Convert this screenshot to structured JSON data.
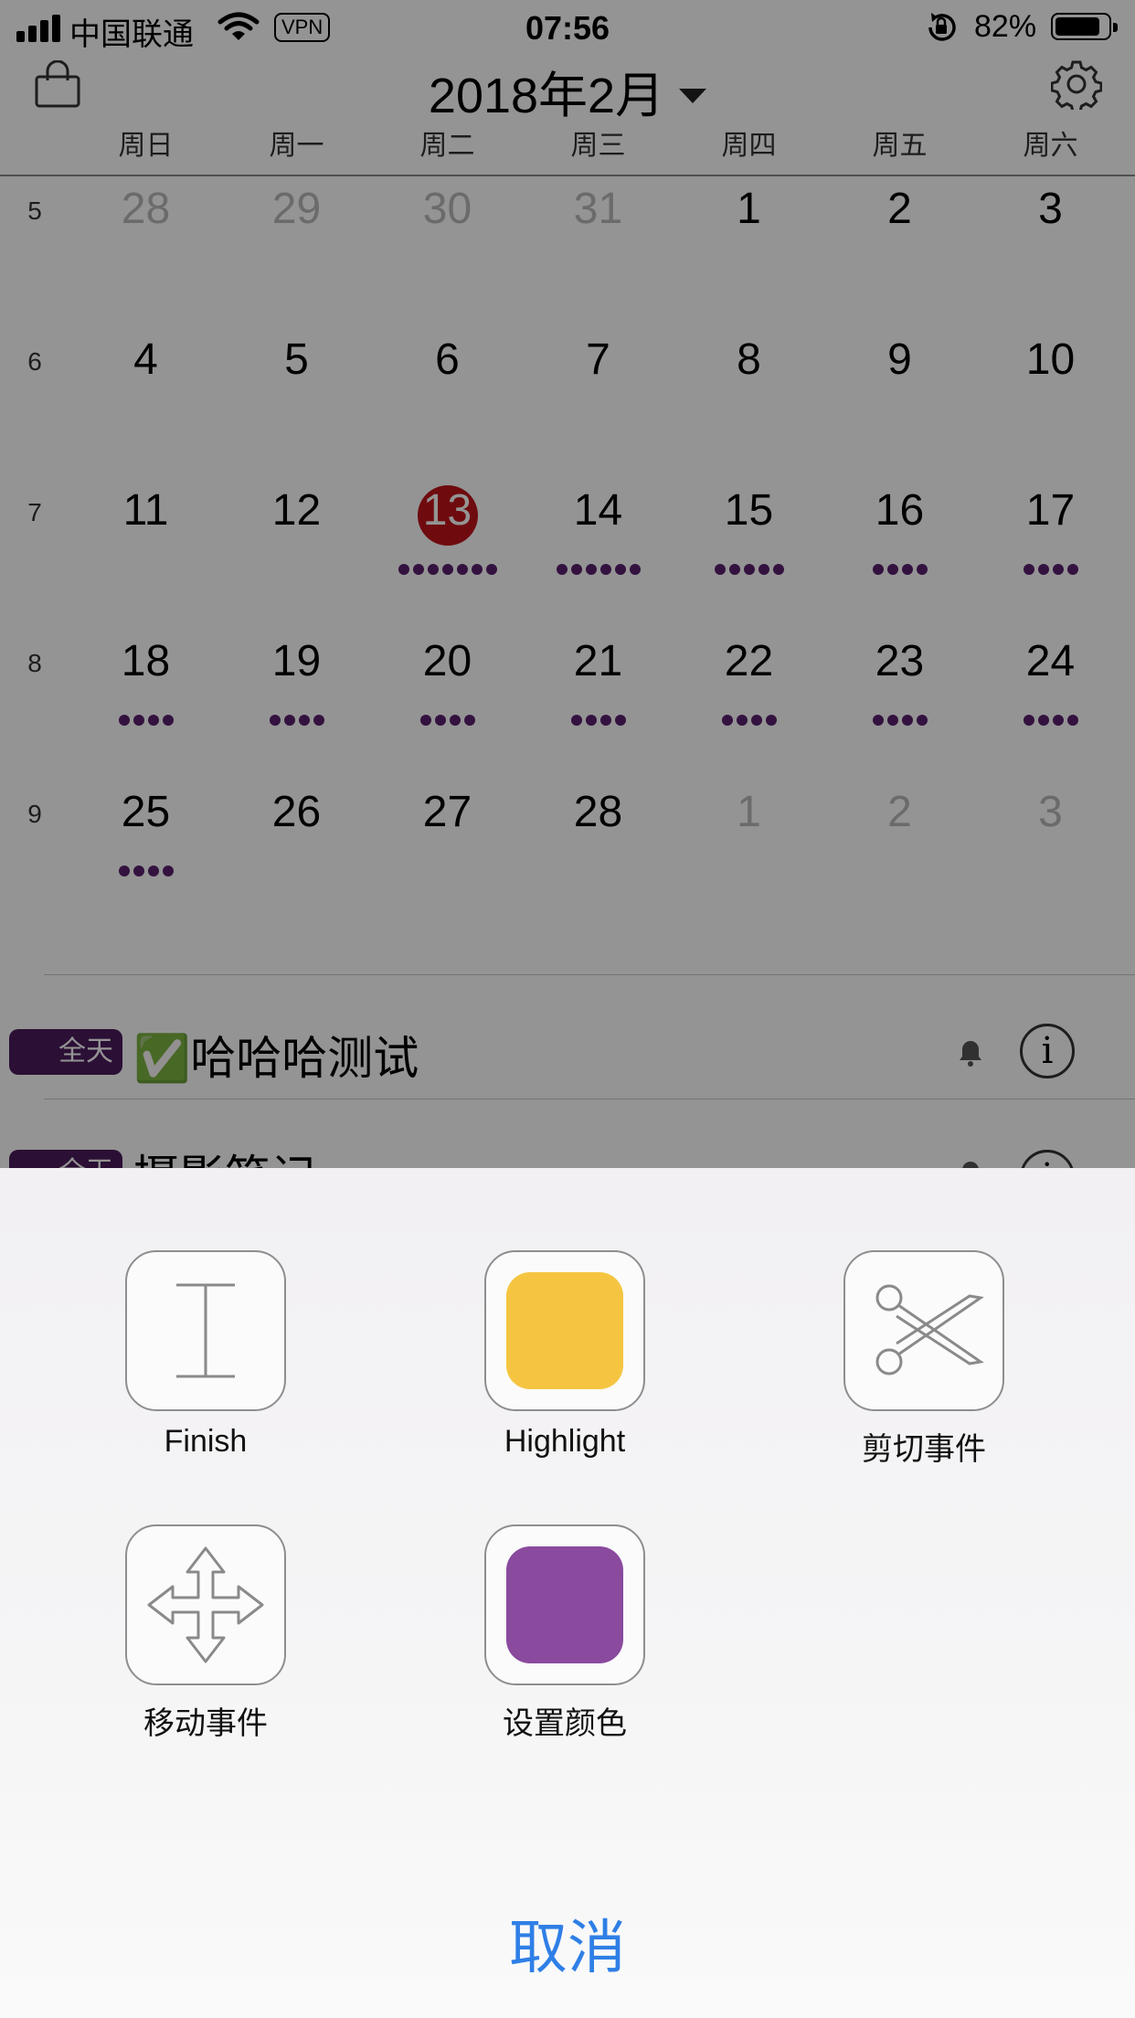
{
  "status_bar": {
    "carrier": "中国联通",
    "vpn": "VPN",
    "time": "07:56",
    "battery": "82%",
    "battery_level": 0.82
  },
  "header": {
    "month_title": "2018年2月"
  },
  "weekdays": [
    "周日",
    "周一",
    "周二",
    "周三",
    "周四",
    "周五",
    "周六"
  ],
  "calendar": {
    "accent_today": "#c0141a",
    "dot_color": "#5b1f6e",
    "weeks": [
      {
        "week": "5",
        "days": [
          {
            "d": "28",
            "dim": true
          },
          {
            "d": "29",
            "dim": true
          },
          {
            "d": "30",
            "dim": true
          },
          {
            "d": "31",
            "dim": true
          },
          {
            "d": "1"
          },
          {
            "d": "2"
          },
          {
            "d": "3"
          }
        ]
      },
      {
        "week": "6",
        "days": [
          {
            "d": "4"
          },
          {
            "d": "5"
          },
          {
            "d": "6"
          },
          {
            "d": "7"
          },
          {
            "d": "8"
          },
          {
            "d": "9"
          },
          {
            "d": "10"
          }
        ]
      },
      {
        "week": "7",
        "days": [
          {
            "d": "11"
          },
          {
            "d": "12"
          },
          {
            "d": "13",
            "today": true,
            "dots": 7
          },
          {
            "d": "14",
            "dots": 6
          },
          {
            "d": "15",
            "dots": 5
          },
          {
            "d": "16",
            "dots": 4
          },
          {
            "d": "17",
            "dots": 4
          }
        ]
      },
      {
        "week": "8",
        "days": [
          {
            "d": "18",
            "dots": 4
          },
          {
            "d": "19",
            "dots": 4
          },
          {
            "d": "20",
            "dots": 4
          },
          {
            "d": "21",
            "dots": 4
          },
          {
            "d": "22",
            "dots": 4
          },
          {
            "d": "23",
            "dots": 4
          },
          {
            "d": "24",
            "dots": 4
          }
        ]
      },
      {
        "week": "9",
        "days": [
          {
            "d": "25",
            "dots": 4
          },
          {
            "d": "26"
          },
          {
            "d": "27"
          },
          {
            "d": "28"
          },
          {
            "d": "1",
            "dim": true
          },
          {
            "d": "2",
            "dim": true
          },
          {
            "d": "3",
            "dim": true
          }
        ]
      }
    ]
  },
  "events": [
    {
      "tag": "全天",
      "title": "✅哈哈哈测试"
    },
    {
      "tag": "全天",
      "title": "摄影笔记"
    }
  ],
  "actions": [
    {
      "label": "Finish",
      "icon": "text-cursor-icon"
    },
    {
      "label": "Highlight",
      "icon": "yellow-swatch-icon",
      "color": "#f5c542"
    },
    {
      "label": "剪切事件",
      "icon": "scissors-icon"
    },
    {
      "label": "移动事件",
      "icon": "move-arrows-icon"
    },
    {
      "label": "设置颜色",
      "icon": "purple-swatch-icon",
      "color": "#8a4a9e"
    }
  ],
  "cancel_label": "取消"
}
